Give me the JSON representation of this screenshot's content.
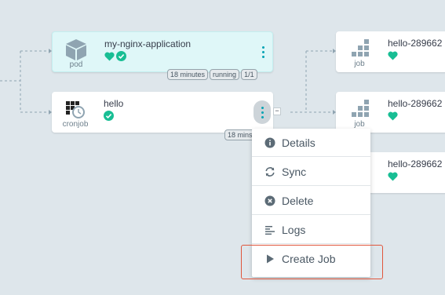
{
  "nodes": {
    "app": {
      "name": "my-nginx-application",
      "kind": "pod",
      "tags": [
        "18 minutes",
        "running",
        "1/1"
      ]
    },
    "hello": {
      "name": "hello",
      "kind": "cronjob",
      "tag": "18 mins"
    },
    "job1": {
      "name": "hello-289662",
      "kind": "job"
    },
    "job2": {
      "name": "hello-289662",
      "kind": "job"
    },
    "job3": {
      "name": "hello-289662"
    }
  },
  "menu": {
    "details": "Details",
    "sync": "Sync",
    "delete": "Delete",
    "logs": "Logs",
    "create_job": "Create Job"
  },
  "colors": {
    "healthy": "#18be94",
    "accent": "#00a2b3",
    "highlight": "#e0563c"
  }
}
